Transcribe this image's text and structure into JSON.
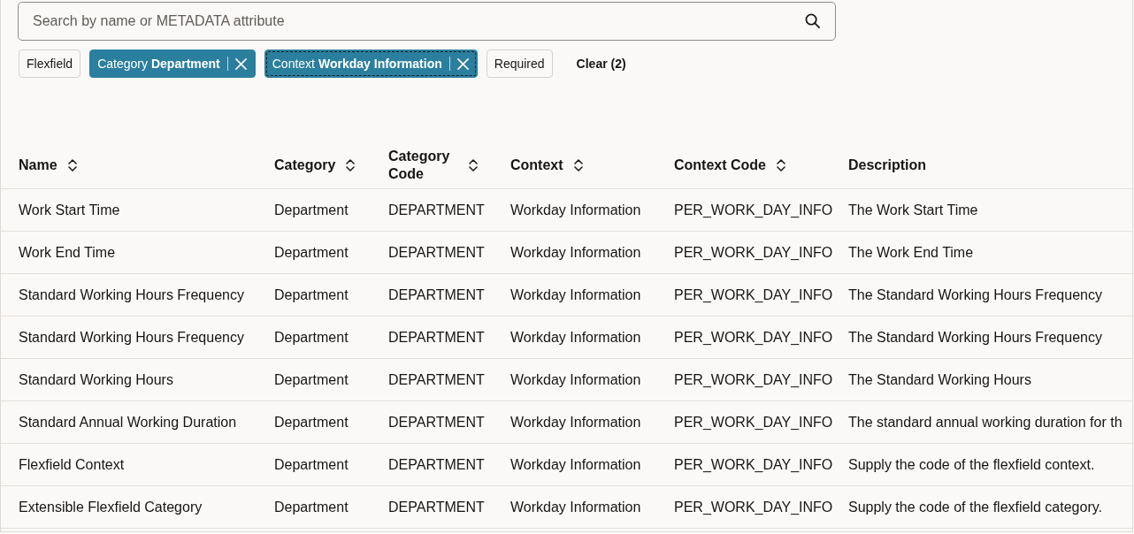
{
  "search": {
    "placeholder": "Search by name or METADATA attribute"
  },
  "filters": [
    {
      "label": "Flexfield",
      "selected": false,
      "focused": false
    },
    {
      "label": "Category",
      "value": "Department",
      "selected": true,
      "focused": false
    },
    {
      "label": "Context",
      "value": "Workday Information",
      "selected": true,
      "focused": true
    },
    {
      "label": "Required",
      "selected": false,
      "focused": false
    }
  ],
  "clear_button": {
    "label": "Clear (2)"
  },
  "table": {
    "columns": [
      {
        "label": "Name",
        "sortable": true
      },
      {
        "label": "Category",
        "sortable": true
      },
      {
        "label": "Category Code",
        "sortable": true
      },
      {
        "label": "Context",
        "sortable": true
      },
      {
        "label": "Context Code",
        "sortable": true
      },
      {
        "label": "Description",
        "sortable": false
      }
    ],
    "rows": [
      [
        "Work Start Time",
        "Department",
        "DEPARTMENT",
        "Workday Information",
        "PER_WORK_DAY_INFO",
        "The Work Start Time"
      ],
      [
        "Work End Time",
        "Department",
        "DEPARTMENT",
        "Workday Information",
        "PER_WORK_DAY_INFO",
        "The Work End Time"
      ],
      [
        "Standard Working Hours Frequency",
        "Department",
        "DEPARTMENT",
        "Workday Information",
        "PER_WORK_DAY_INFO",
        "The Standard Working Hours Frequency"
      ],
      [
        "Standard Working Hours Frequency",
        "Department",
        "DEPARTMENT",
        "Workday Information",
        "PER_WORK_DAY_INFO",
        "The Standard Working Hours Frequency"
      ],
      [
        "Standard Working Hours",
        "Department",
        "DEPARTMENT",
        "Workday Information",
        "PER_WORK_DAY_INFO",
        "The Standard Working Hours"
      ],
      [
        "Standard Annual Working Duration",
        "Department",
        "DEPARTMENT",
        "Workday Information",
        "PER_WORK_DAY_INFO",
        "The standard annual working duration for th"
      ],
      [
        "Flexfield Context",
        "Department",
        "DEPARTMENT",
        "Workday Information",
        "PER_WORK_DAY_INFO",
        "Supply the code of the flexfield context."
      ],
      [
        "Extensible Flexfield Category",
        "Department",
        "DEPARTMENT",
        "Workday Information",
        "PER_WORK_DAY_INFO",
        "Supply the code of the flexfield category."
      ]
    ]
  }
}
